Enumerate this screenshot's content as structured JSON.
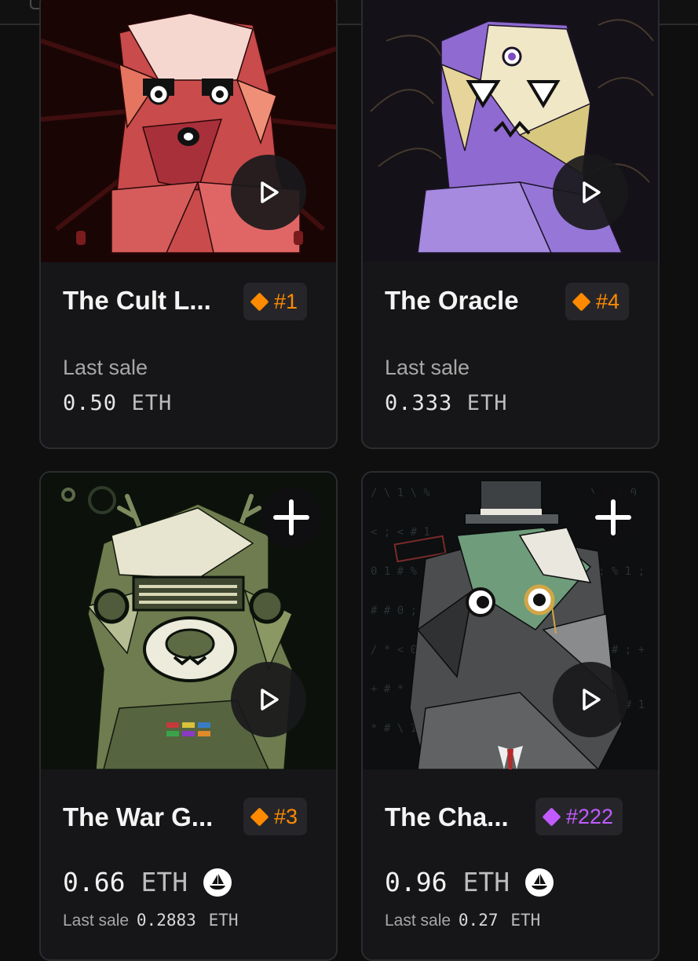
{
  "colors": {
    "background": "#0f0f10",
    "card": "#161618",
    "orange_rank": "#ff8a00",
    "purple_rank": "#c25bff"
  },
  "cards": [
    {
      "title": "The Cult L...",
      "rank": "#1",
      "rank_color": "#ff8a00",
      "last_sale_label": "Last sale",
      "last_sale_value": "0.50",
      "last_sale_currency": "ETH",
      "art_icon": "red-geometric-creature",
      "play_icon": "play-icon"
    },
    {
      "title": "The Oracle",
      "rank": "#4",
      "rank_color": "#ff8a00",
      "last_sale_label": "Last sale",
      "last_sale_value": "0.333",
      "last_sale_currency": "ETH",
      "art_icon": "purple-geometric-creature",
      "play_icon": "play-icon"
    },
    {
      "title": "The War G...",
      "rank": "#3",
      "rank_color": "#ff8a00",
      "price_value": "0.66",
      "price_currency": "ETH",
      "last_sale_label": "Last sale",
      "last_sale_value": "0.2883",
      "last_sale_currency": "ETH",
      "art_icon": "green-antlered-creature",
      "add_icon": "plus-icon",
      "play_icon": "play-icon"
    },
    {
      "title": "The Cha...",
      "rank": "#222",
      "rank_color": "#c25bff",
      "price_value": "0.96",
      "price_currency": "ETH",
      "last_sale_label": "Last sale",
      "last_sale_value": "0.27",
      "last_sale_currency": "ETH",
      "art_icon": "top-hat-monocle-creature",
      "add_icon": "plus-icon",
      "play_icon": "play-icon"
    }
  ]
}
